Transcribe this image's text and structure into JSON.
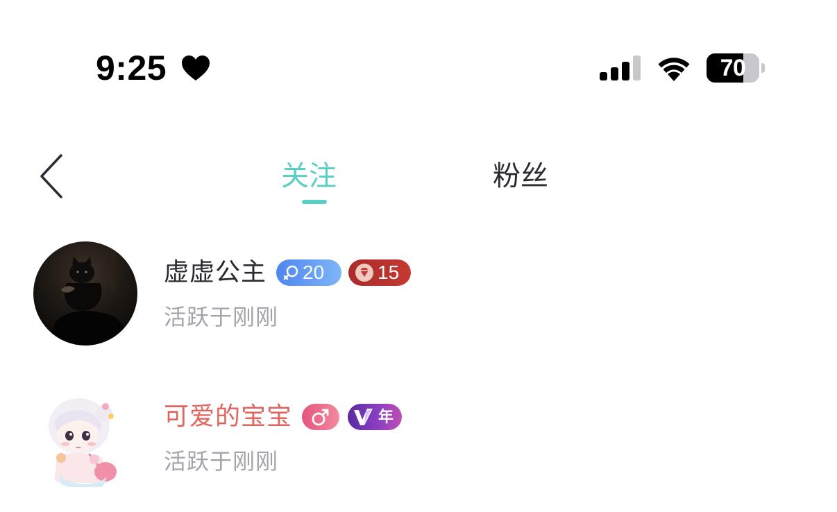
{
  "status_bar": {
    "time": "9:25",
    "battery": "70",
    "battery_level_percent": 70,
    "icons": [
      "heart-icon",
      "signal-icon",
      "wifi-icon",
      "battery-icon"
    ]
  },
  "nav": {
    "back_icon": "chevron-left-icon",
    "tabs": [
      {
        "label": "关注",
        "active": true
      },
      {
        "label": "粉丝",
        "active": false
      }
    ],
    "active_color": "#5ccfc4"
  },
  "users": [
    {
      "name": "虚虚公主",
      "name_color": "#2a2a30",
      "level_badge": "20",
      "wealth_badge": "15",
      "activity": "活跃于刚刚",
      "avatar": "dark-cat-photo"
    },
    {
      "name": "可爱的宝宝",
      "name_color": "#e0655f",
      "gender_icon": "male-icon",
      "vip_badge": "年",
      "activity": "活跃于刚刚",
      "avatar": "anime-girl-illustration"
    }
  ]
}
